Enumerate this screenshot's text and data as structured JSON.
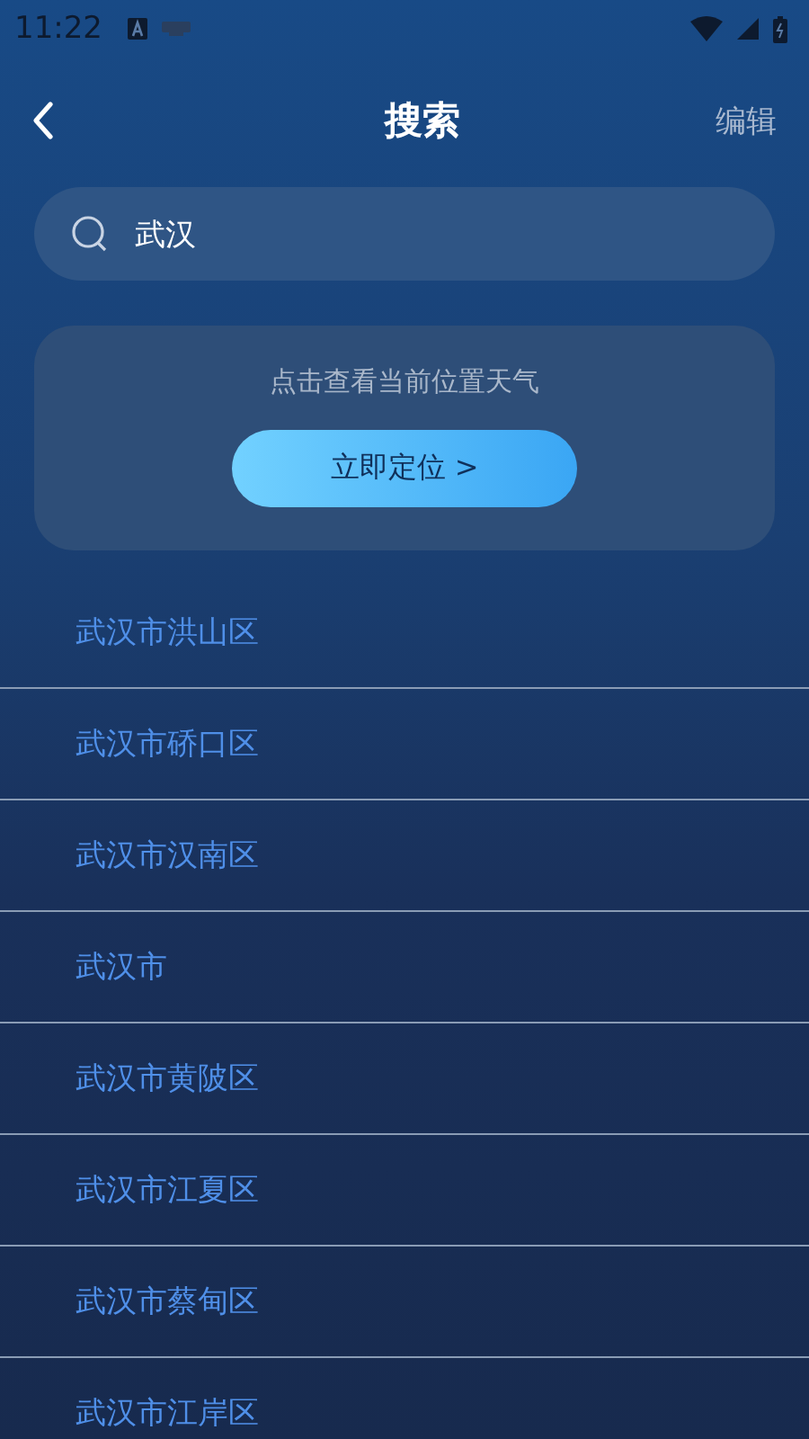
{
  "status_bar": {
    "time": "11:22"
  },
  "header": {
    "title": "搜索",
    "action": "编辑"
  },
  "search": {
    "value": "武汉"
  },
  "locate_card": {
    "hint": "点击查看当前位置天气",
    "button": "立即定位 >"
  },
  "results": [
    "武汉市洪山区",
    "武汉市硚口区",
    "武汉市汉南区",
    "武汉市",
    "武汉市黄陂区",
    "武汉市江夏区",
    "武汉市蔡甸区",
    "武汉市江岸区"
  ]
}
